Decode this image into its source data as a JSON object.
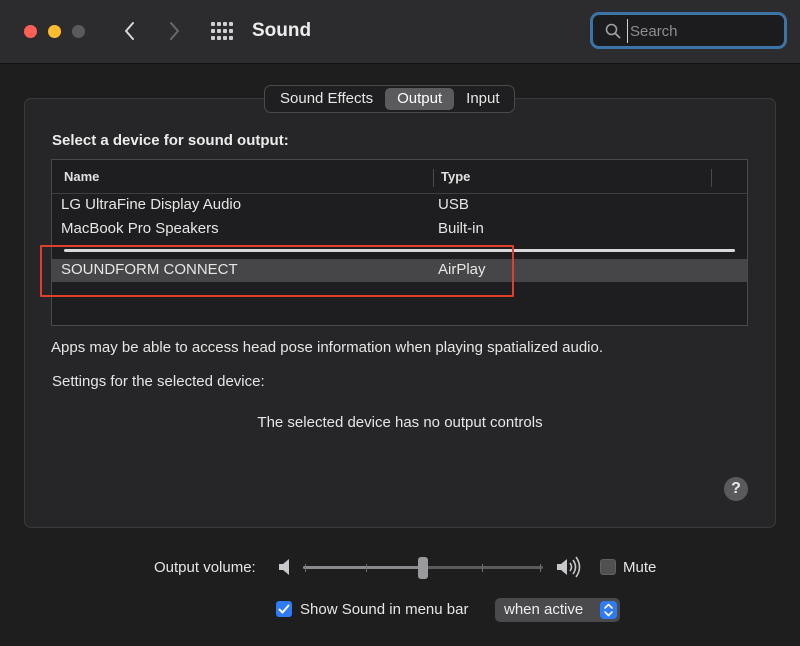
{
  "window": {
    "title": "Sound",
    "search_placeholder": "Search"
  },
  "tabs": [
    {
      "label": "Sound Effects",
      "active": false
    },
    {
      "label": "Output",
      "active": true
    },
    {
      "label": "Input",
      "active": false
    }
  ],
  "output": {
    "heading": "Select a device for sound output:",
    "columns": [
      "Name",
      "Type"
    ],
    "devices": [
      {
        "name": "LG UltraFine Display Audio",
        "type": "USB"
      },
      {
        "name": "MacBook Pro Speakers",
        "type": "Built-in"
      },
      {
        "name": "SOUNDFORM CONNECT",
        "type": "AirPlay",
        "selected": true
      }
    ],
    "note": "Apps may be able to access head pose information when playing spatialized audio.",
    "settings_label": "Settings for the selected device:",
    "no_controls": "The selected device has no output controls",
    "help_label": "?"
  },
  "volume": {
    "label": "Output volume:",
    "level": 0.5,
    "mute_label": "Mute",
    "muted": false
  },
  "menubar": {
    "show_label": "Show Sound in menu bar",
    "checked": true,
    "mode": "when active"
  },
  "colors": {
    "accent": "#2f7bf6",
    "highlight_box": "#e03e2e",
    "search_focus": "#3d74a8"
  },
  "icons": [
    "back-icon",
    "forward-icon",
    "grid-icon",
    "search-icon",
    "speaker-low-icon",
    "speaker-high-icon",
    "checkmark-icon",
    "updown-arrows-icon",
    "help-icon"
  ]
}
